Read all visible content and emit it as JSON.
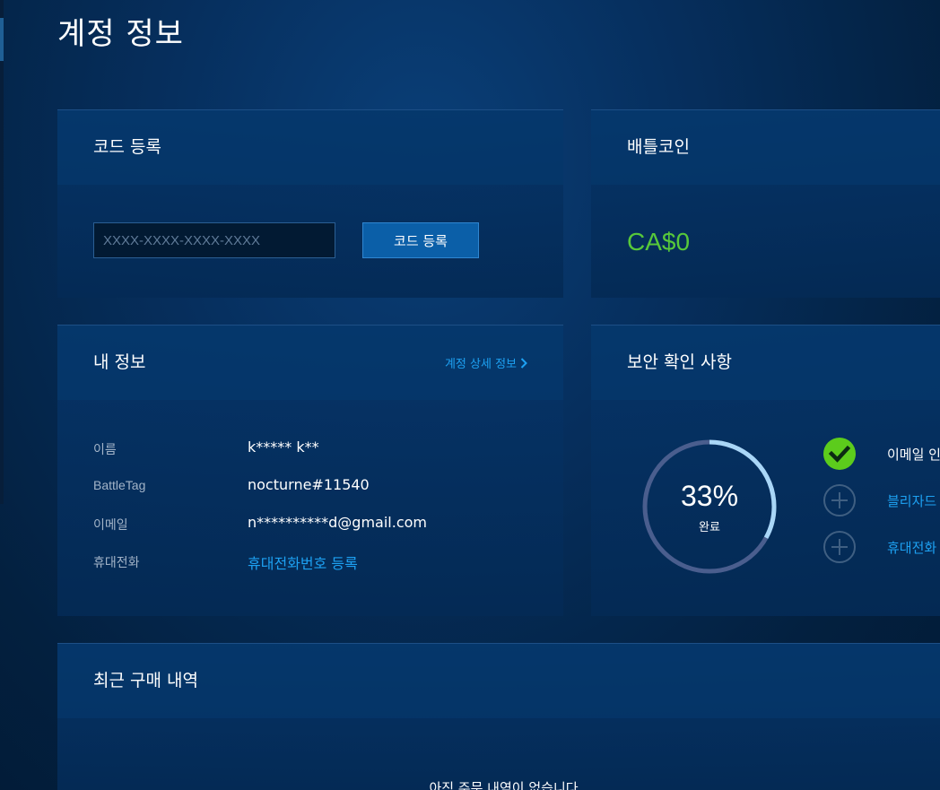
{
  "page": {
    "title": "계정 정보"
  },
  "code": {
    "title": "코드 등록",
    "placeholder": "XXXX-XXXX-XXXX-XXXX",
    "value": "",
    "button_label": "코드 등록"
  },
  "battlecoin": {
    "title": "배틀코인",
    "balance": "CA$0"
  },
  "info": {
    "title": "내 정보",
    "detail_link": "계정 상세 정보",
    "rows": [
      {
        "label": "이름",
        "value": "k***** k**"
      },
      {
        "label": "BattleTag",
        "value": "nocturne#11540"
      },
      {
        "label": "이메일",
        "value": "n**********d@gmail.com"
      },
      {
        "label": "휴대전화",
        "value": "휴대전화번호 등록"
      }
    ]
  },
  "security": {
    "title": "보안 확인 사항",
    "percent_text": "33%",
    "percent_value": 33,
    "complete_label": "완료",
    "items": [
      {
        "text": "이메일 인",
        "icon": "check-icon",
        "done": true
      },
      {
        "text": "블리자드",
        "icon": "plus-circle-icon",
        "done": false
      },
      {
        "text": "휴대전화",
        "icon": "plus-circle-icon",
        "done": false
      }
    ]
  },
  "purchases": {
    "title": "최근 구매 내역",
    "empty_message": "아직 주문 내역이 없습니다"
  },
  "colors": {
    "accent_blue": "#1da1f2",
    "success_green": "#57c83a",
    "button_blue": "#0b5fa8"
  }
}
